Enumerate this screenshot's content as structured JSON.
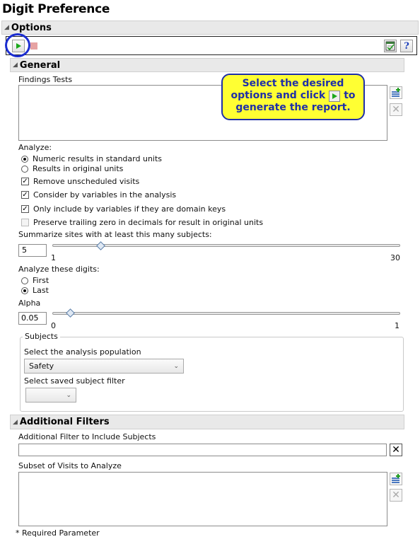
{
  "title": "Digit Preference",
  "options_header": "Options",
  "general_header": "General",
  "findings_label": "Findings Tests",
  "callout": {
    "line1": "Select the desired",
    "line2a": "options and click",
    "line2b": "to",
    "line3": "generate the report."
  },
  "analyze_label": "Analyze:",
  "analyze_options": [
    "Numeric results in standard units",
    "Results in original units"
  ],
  "checkboxes": [
    "Remove unscheduled visits",
    "Consider by variables in the analysis",
    "Only include by variables if they are domain keys",
    "Preserve trailing zero in decimals for result in original units"
  ],
  "sites_label": "Summarize sites with at least this many subjects:",
  "sites_value": "5",
  "sites_min": "1",
  "sites_max": "30",
  "digits_label": "Analyze these digits:",
  "digit_options": [
    "First",
    "Last"
  ],
  "alpha_label": "Alpha",
  "alpha_value": "0.05",
  "alpha_min": "0",
  "alpha_max": "1",
  "subjects_legend": "Subjects",
  "population_label": "Select the analysis population",
  "population_value": "Safety",
  "saved_filter_label": "Select saved subject filter",
  "additional_header": "Additional Filters",
  "addl_filter_label": "Additional Filter to Include Subjects",
  "visits_label": "Subset of Visits to Analyze",
  "required_note": "* Required Parameter"
}
